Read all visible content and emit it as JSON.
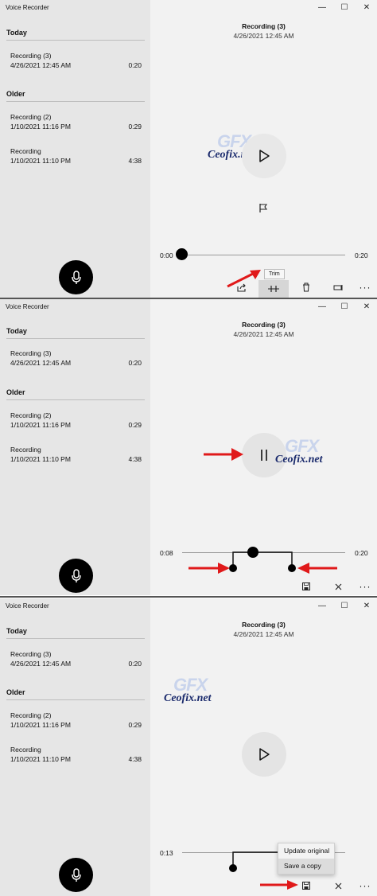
{
  "app_title": "Voice Recorder",
  "window_controls": {
    "minimize": "—",
    "maximize": "☐",
    "close": "✕"
  },
  "groups": {
    "today": "Today",
    "older": "Older"
  },
  "recordings": [
    {
      "name": "Recording (3)",
      "date": "4/26/2021 12:45 AM",
      "duration": "0:20"
    },
    {
      "name": "Recording (2)",
      "date": "1/10/2021 11:16 PM",
      "duration": "0:29"
    },
    {
      "name": "Recording",
      "date": "1/10/2021 11:10 PM",
      "duration": "4:38"
    }
  ],
  "current": {
    "title": "Recording (3)",
    "date": "4/26/2021 12:45 AM"
  },
  "watermark": "Ceofix.net",
  "watermark_gfx": "GFX",
  "panel1": {
    "time_start": "0:00",
    "time_end": "0:20",
    "tooltip": "Trim"
  },
  "panel2": {
    "time_start": "0:08",
    "time_end": "0:20"
  },
  "panel3": {
    "time_start": "0:13",
    "menu": [
      "Update original",
      "Save a copy"
    ]
  },
  "icons": [
    "mic-icon",
    "play-icon",
    "pause-icon",
    "flag-icon",
    "share-icon",
    "trim-icon",
    "delete-icon",
    "rename-icon",
    "more-icon",
    "save-icon",
    "close-icon",
    "arrow-icon"
  ],
  "colors": {
    "accent_arrow": "#e0191a",
    "sidebar": "#e6e6e6",
    "main": "#f2f2f2"
  }
}
